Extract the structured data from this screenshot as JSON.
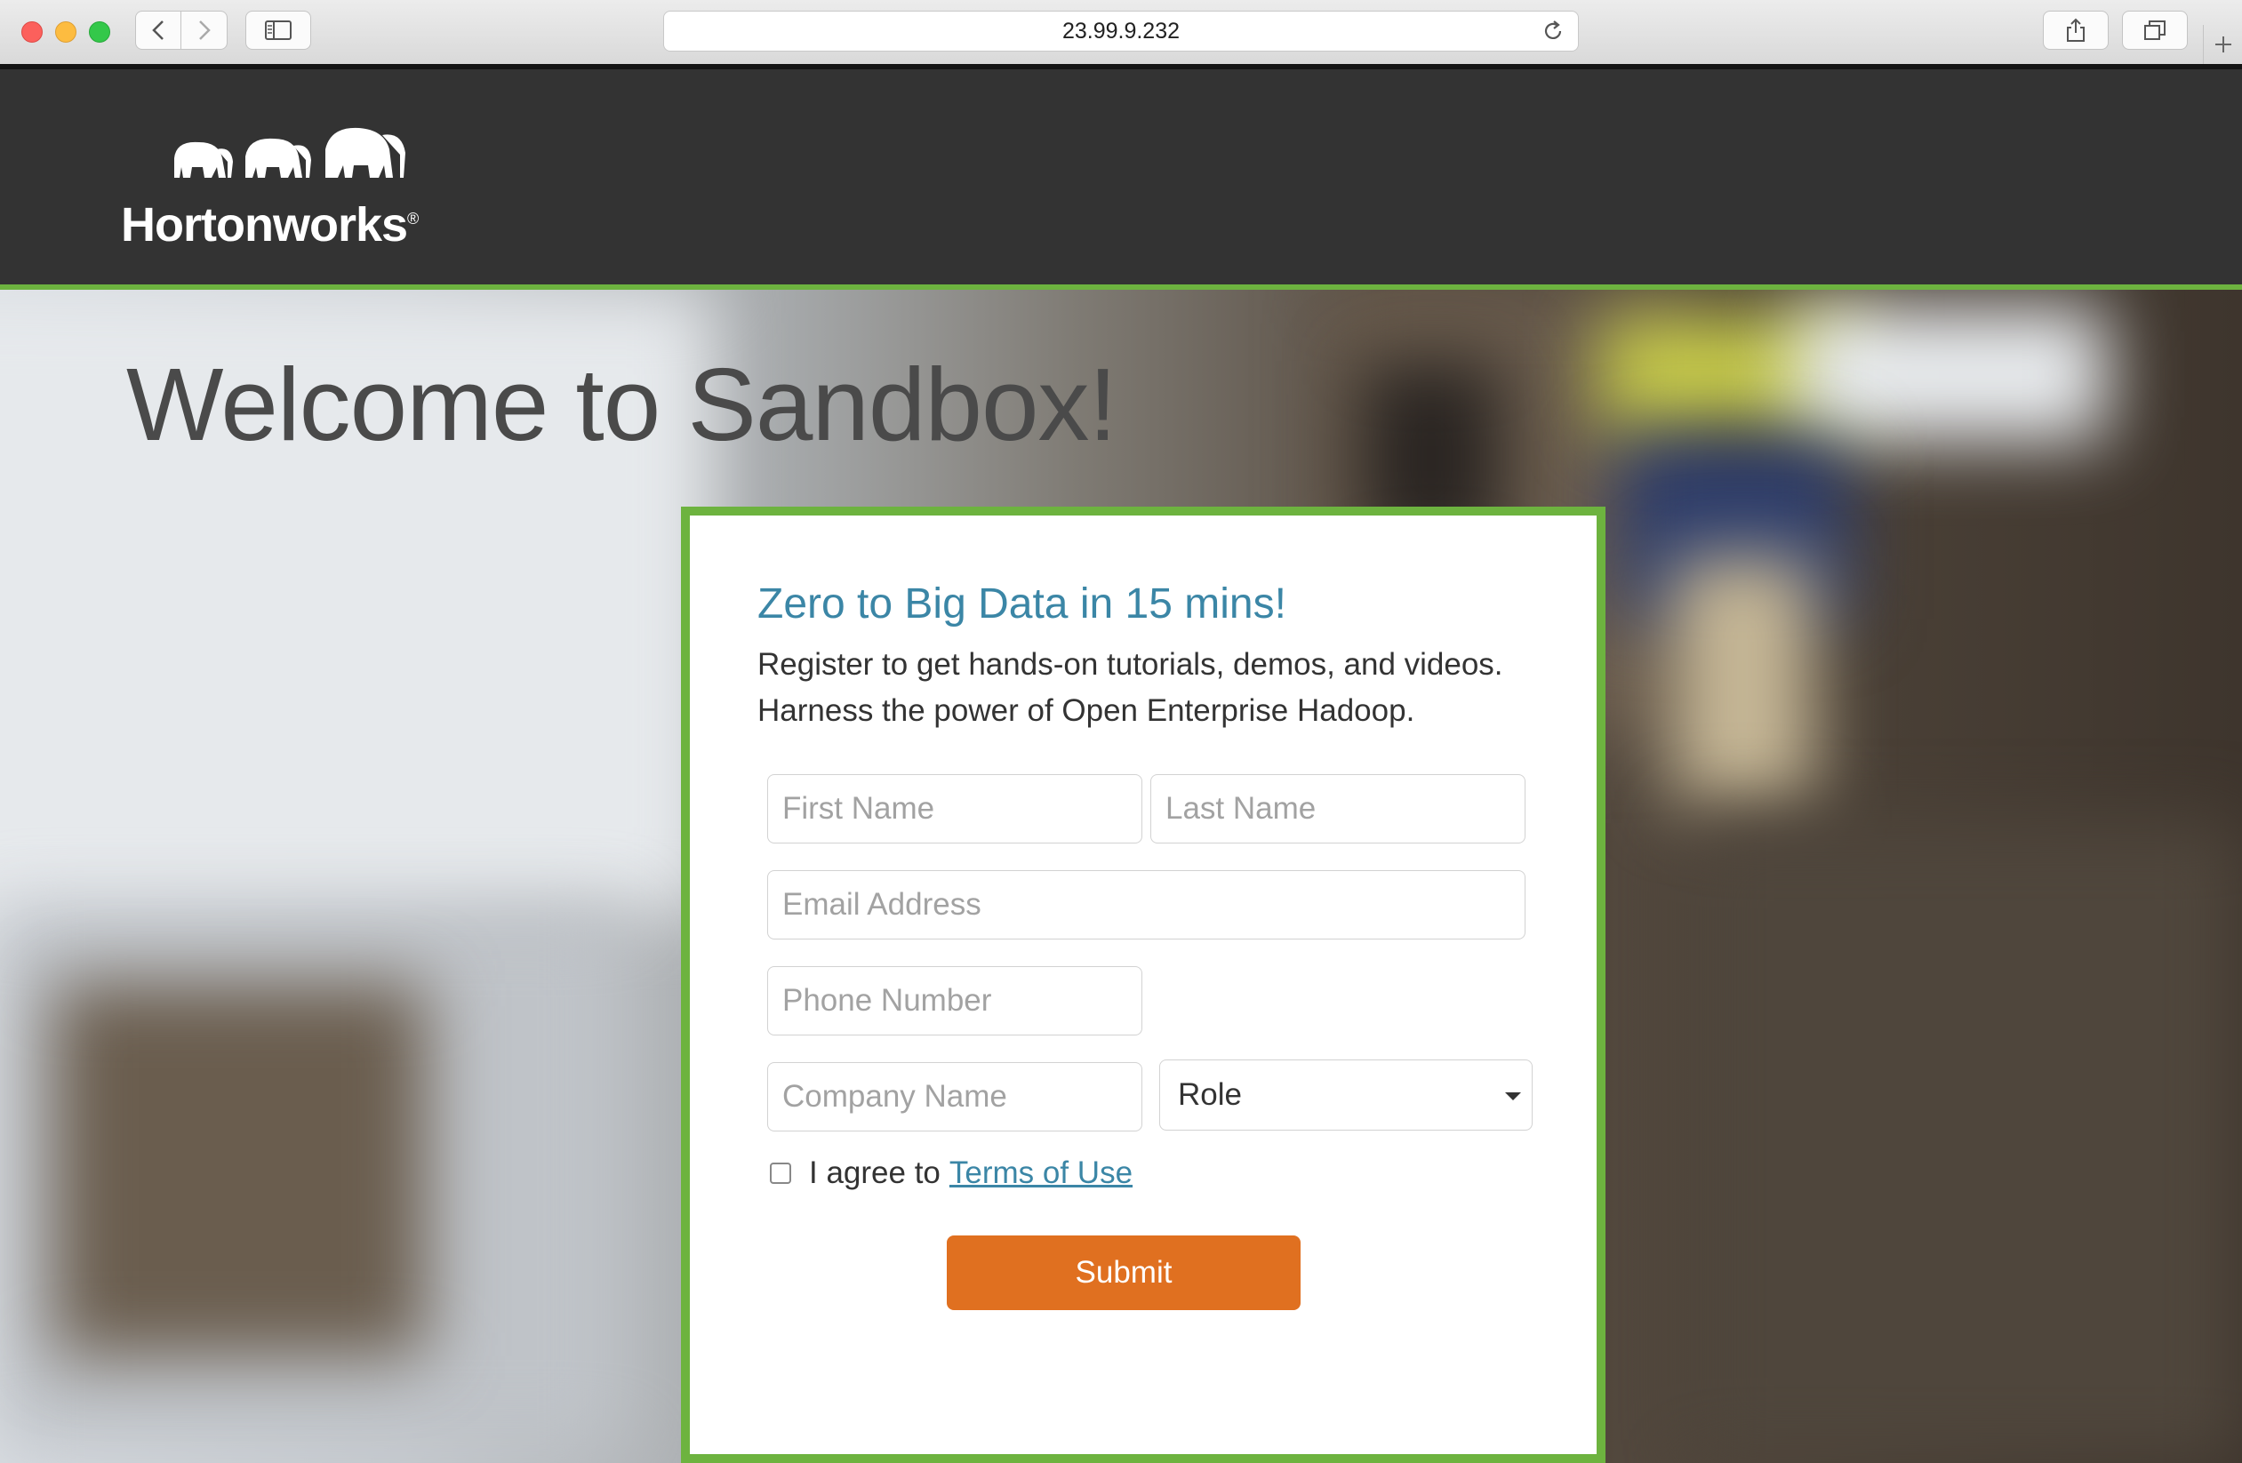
{
  "browser": {
    "url": "23.99.9.232"
  },
  "header": {
    "logo_text": "Hortonworks",
    "registered_mark": "®"
  },
  "hero": {
    "heading": "Welcome to Sandbox!"
  },
  "form": {
    "title": "Zero to Big Data in 15 mins!",
    "description_line1": "Register to get hands-on tutorials, demos, and videos.",
    "description_line2": "Harness the power of Open Enterprise Hadoop.",
    "first_name_placeholder": "First Name",
    "last_name_placeholder": "Last Name",
    "email_placeholder": "Email Address",
    "phone_placeholder": "Phone Number",
    "company_placeholder": "Company Name",
    "role_selected": "Role",
    "agree_text": "I agree to",
    "terms_link": "Terms of Use",
    "submit_label": "Submit"
  },
  "colors": {
    "accent_green": "#6db33f",
    "link_blue": "#3b86a6",
    "submit_orange": "#e07020",
    "header_bg": "#333333"
  },
  "icons": [
    "back-icon",
    "forward-icon",
    "sidebar-icon",
    "reload-icon",
    "share-icon",
    "tabs-icon",
    "plus-icon",
    "elephant-logo-icon",
    "dropdown-caret-icon"
  ]
}
